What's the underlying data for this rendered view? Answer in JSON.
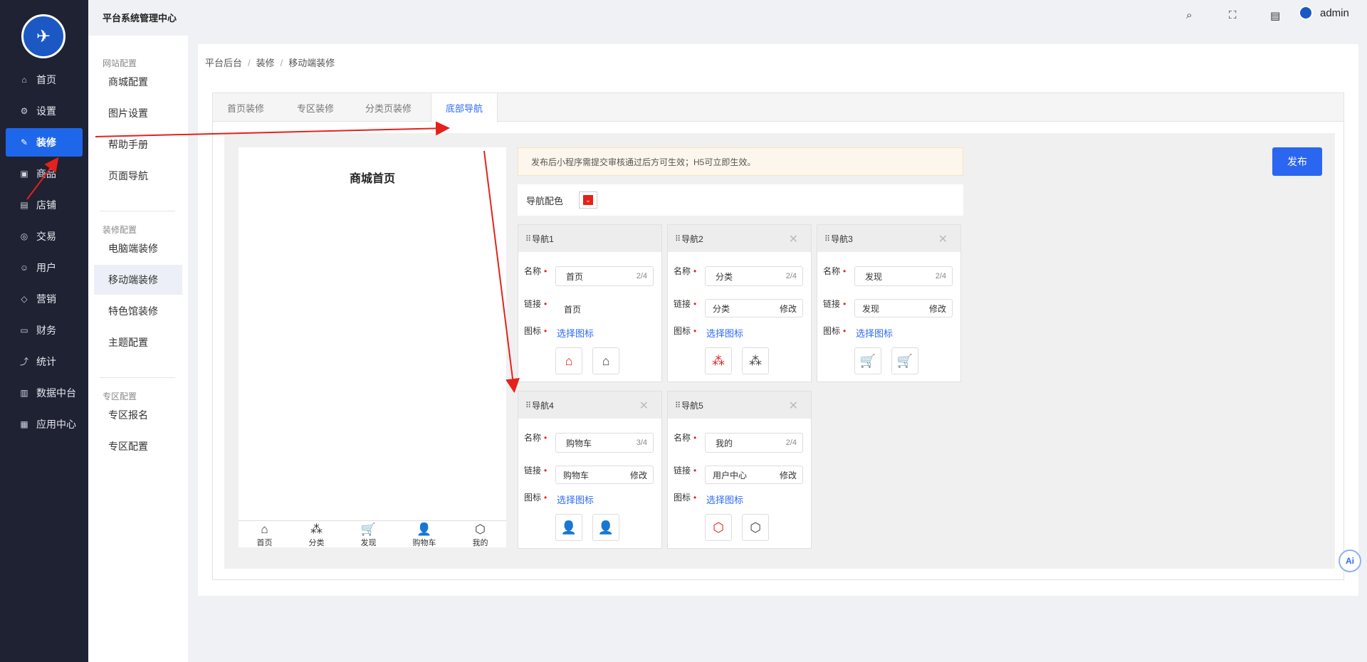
{
  "topbar": {
    "title": "平台系统管理中心",
    "user": "admin"
  },
  "sidebar": {
    "items": [
      {
        "label": "首页",
        "icon": "home-icon"
      },
      {
        "label": "设置",
        "icon": "gear-icon"
      },
      {
        "label": "装修",
        "icon": "brush-icon"
      },
      {
        "label": "商品",
        "icon": "box-icon"
      },
      {
        "label": "店铺",
        "icon": "store-icon"
      },
      {
        "label": "交易",
        "icon": "coin-icon"
      },
      {
        "label": "用户",
        "icon": "user-icon"
      },
      {
        "label": "营销",
        "icon": "tag-icon"
      },
      {
        "label": "财务",
        "icon": "wallet-icon"
      },
      {
        "label": "统计",
        "icon": "chart-icon"
      },
      {
        "label": "数据中台",
        "icon": "monitor-icon"
      },
      {
        "label": "应用中心",
        "icon": "apps-icon"
      }
    ]
  },
  "submenu": {
    "sections": [
      {
        "title": "网站配置",
        "items": [
          "商城配置",
          "图片设置",
          "帮助手册",
          "页面导航"
        ]
      },
      {
        "title": "装修配置",
        "items": [
          "电脑端装修",
          "移动端装修",
          "特色馆装修",
          "主题配置"
        ]
      },
      {
        "title": "专区配置",
        "items": [
          "专区报名",
          "专区配置"
        ]
      }
    ]
  },
  "breadcrumb": [
    "平台后台",
    "装修",
    "移动端装修"
  ],
  "tabs": [
    "首页装修",
    "专区装修",
    "分类页装修",
    "底部导航"
  ],
  "preview": {
    "title": "商城首页",
    "bar": [
      {
        "label": "首页",
        "icon": "home-icon"
      },
      {
        "label": "分类",
        "icon": "grid-icon"
      },
      {
        "label": "发现",
        "icon": "cart-icon"
      },
      {
        "label": "购物车",
        "icon": "user-icon"
      },
      {
        "label": "我的",
        "icon": "cube-icon"
      }
    ]
  },
  "notice": "发布后小程序需提交审核通过后方可生效；H5可立即生效。",
  "publish_label": "发布",
  "color_label": "导航配色",
  "accent_color": "#e6201b",
  "labels": {
    "name": "名称",
    "link": "链接",
    "icon": "图标",
    "pick": "选择图标",
    "edit": "修改"
  },
  "navs": [
    {
      "title": "导航1",
      "name": "首页",
      "count": "2/4",
      "link": "首页",
      "editable": false,
      "glyph": "⌂",
      "icon": "home-icon"
    },
    {
      "title": "导航2",
      "name": "分类",
      "count": "2/4",
      "link": "分类",
      "editable": true,
      "glyph": "⁂",
      "icon": "grid-icon"
    },
    {
      "title": "导航3",
      "name": "发现",
      "count": "2/4",
      "link": "发现",
      "editable": true,
      "glyph": "🛒",
      "icon": "cart-icon"
    },
    {
      "title": "导航4",
      "name": "购物车",
      "count": "3/4",
      "link": "购物车",
      "editable": true,
      "glyph": "👤",
      "icon": "user-icon"
    },
    {
      "title": "导航5",
      "name": "我的",
      "count": "2/4",
      "link": "用户中心",
      "editable": true,
      "glyph": "⬡",
      "icon": "cube-icon"
    }
  ],
  "ai_label": "Ai"
}
